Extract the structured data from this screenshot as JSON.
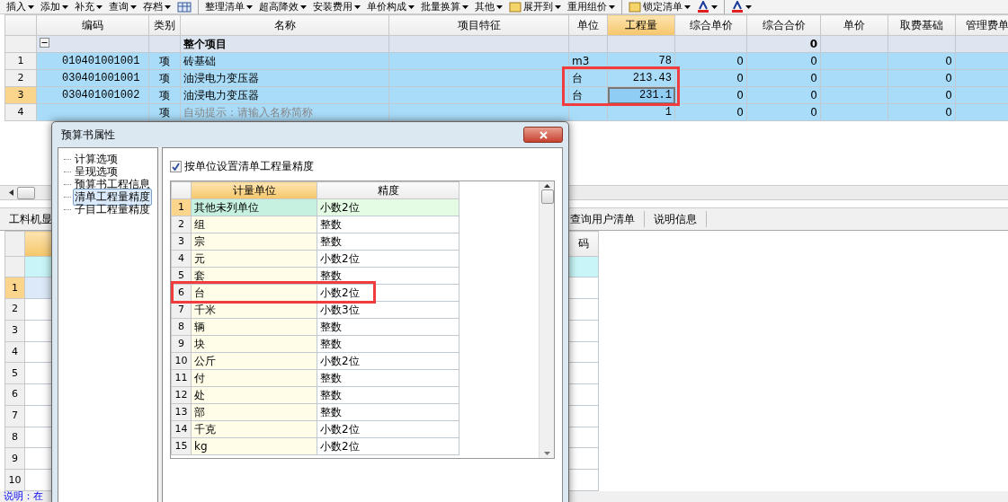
{
  "toolbar": [
    {
      "kind": "menu",
      "label": "插入"
    },
    {
      "kind": "menu",
      "label": "添加"
    },
    {
      "kind": "menu",
      "label": "补充"
    },
    {
      "kind": "menu",
      "label": "查询"
    },
    {
      "kind": "menu",
      "label": "存档"
    },
    {
      "kind": "icon"
    },
    {
      "kind": "separator"
    },
    {
      "kind": "menu",
      "label": "整理清单"
    },
    {
      "kind": "menu",
      "label": "超高降效"
    },
    {
      "kind": "menu",
      "label": "安装费用"
    },
    {
      "kind": "menu",
      "label": "单价构成"
    },
    {
      "kind": "menu",
      "label": "批量换算"
    },
    {
      "kind": "menu",
      "label": "其他"
    },
    {
      "kind": "icon-menu",
      "label": "展开到"
    },
    {
      "kind": "menu",
      "label": "重用组价"
    },
    {
      "kind": "separator"
    },
    {
      "kind": "icon-menu",
      "label": "锁定清单"
    },
    {
      "kind": "color",
      "color": "#e02020"
    },
    {
      "kind": "separator"
    },
    {
      "kind": "color",
      "color": "#e02020"
    }
  ],
  "main_table": {
    "columns": [
      {
        "label": "编码",
        "selected": false
      },
      {
        "label": "类别",
        "selected": false
      },
      {
        "label": "名称",
        "selected": false
      },
      {
        "label": "项目特征",
        "selected": false
      },
      {
        "label": "单位",
        "selected": false
      },
      {
        "label": "工程量",
        "selected": true
      },
      {
        "label": "综合单价",
        "selected": false
      },
      {
        "label": "综合合价",
        "selected": false
      },
      {
        "label": "单价",
        "selected": false
      },
      {
        "label": "取费基础",
        "selected": false
      },
      {
        "label": "管理费单",
        "selected": false
      }
    ],
    "summary_row": {
      "name": "整个项目",
      "total": "0",
      "expanded": true
    },
    "rows": [
      {
        "number": "1",
        "code": "010401001001",
        "type": "项",
        "name": "砖基础",
        "unit": "m3",
        "quantity": "78",
        "unit_price": "0",
        "total_price": "0",
        "fee_base": "0",
        "selected": false,
        "highlighted": false
      },
      {
        "number": "2",
        "code": "030401001001",
        "type": "项",
        "name": "油浸电力变压器",
        "unit": "台",
        "quantity": "213.43",
        "unit_price": "0",
        "total_price": "0",
        "fee_base": "0",
        "selected": false,
        "highlighted": true
      },
      {
        "number": "3",
        "code": "030401001002",
        "type": "项",
        "name": "油浸电力变压器",
        "unit": "台",
        "quantity": "231.1",
        "unit_price": "0",
        "total_price": "0",
        "fee_base": "0",
        "selected": true,
        "highlighted": true
      },
      {
        "number": "4",
        "type": "项",
        "placeholder": "自动提示：请输入名称简称",
        "quantity": "1",
        "unit_price": "0",
        "total_price": "0",
        "fee_base": "0",
        "selected": false,
        "highlighted": false
      }
    ]
  },
  "bottom_panel": {
    "tabs": [
      {
        "label": "工料机显"
      },
      {
        "label": "查询用户清单"
      },
      {
        "label": "说明信息"
      }
    ],
    "column_3": "码",
    "rows": [
      {
        "number": "1",
        "selected": true
      },
      {
        "number": "2",
        "selected": false
      },
      {
        "number": "3",
        "selected": false
      },
      {
        "number": "4",
        "selected": false
      },
      {
        "number": "5",
        "selected": false
      },
      {
        "number": "6",
        "selected": false
      },
      {
        "number": "7",
        "selected": false
      },
      {
        "number": "8",
        "selected": false
      },
      {
        "number": "9",
        "selected": false
      },
      {
        "number": "10",
        "selected": false
      }
    ]
  },
  "status_bar": "说明：在",
  "dialog": {
    "title": "预算书属性",
    "tree": [
      {
        "label": "计算选项",
        "selected": false
      },
      {
        "label": "呈现选项",
        "selected": false
      },
      {
        "label": "预算书工程信息",
        "selected": false
      },
      {
        "label": "清单工程量精度",
        "selected": true
      },
      {
        "label": "子目工程量精度",
        "selected": false
      }
    ],
    "checkbox": {
      "label": "按单位设置清单工程量精度",
      "checked": true
    },
    "columns": [
      "计量单位",
      "精度"
    ],
    "rows": [
      {
        "number": "1",
        "unit": "其他未列单位",
        "precision": "小数2位",
        "selected": true,
        "highlighted": false
      },
      {
        "number": "2",
        "unit": "组",
        "precision": "整数",
        "selected": false,
        "highlighted": false
      },
      {
        "number": "3",
        "unit": "宗",
        "precision": "整数",
        "selected": false,
        "highlighted": false
      },
      {
        "number": "4",
        "unit": "元",
        "precision": "小数2位",
        "selected": false,
        "highlighted": false
      },
      {
        "number": "5",
        "unit": "套",
        "precision": "整数",
        "selected": false,
        "highlighted": false
      },
      {
        "number": "6",
        "unit": "台",
        "precision": "小数2位",
        "selected": false,
        "highlighted": true
      },
      {
        "number": "7",
        "unit": "千米",
        "precision": "小数3位",
        "selected": false,
        "highlighted": false
      },
      {
        "number": "8",
        "unit": "辆",
        "precision": "整数",
        "selected": false,
        "highlighted": false
      },
      {
        "number": "9",
        "unit": "块",
        "precision": "整数",
        "selected": false,
        "highlighted": false
      },
      {
        "number": "10",
        "unit": "公斤",
        "precision": "小数2位",
        "selected": false,
        "highlighted": false
      },
      {
        "number": "11",
        "unit": "付",
        "precision": "整数",
        "selected": false,
        "highlighted": false
      },
      {
        "number": "12",
        "unit": "处",
        "precision": "整数",
        "selected": false,
        "highlighted": false
      },
      {
        "number": "13",
        "unit": "部",
        "precision": "整数",
        "selected": false,
        "highlighted": false
      },
      {
        "number": "14",
        "unit": "千克",
        "precision": "小数2位",
        "selected": false,
        "highlighted": false
      },
      {
        "number": "15",
        "unit": "kg",
        "precision": "小数2位",
        "selected": false,
        "highlighted": false
      }
    ]
  }
}
